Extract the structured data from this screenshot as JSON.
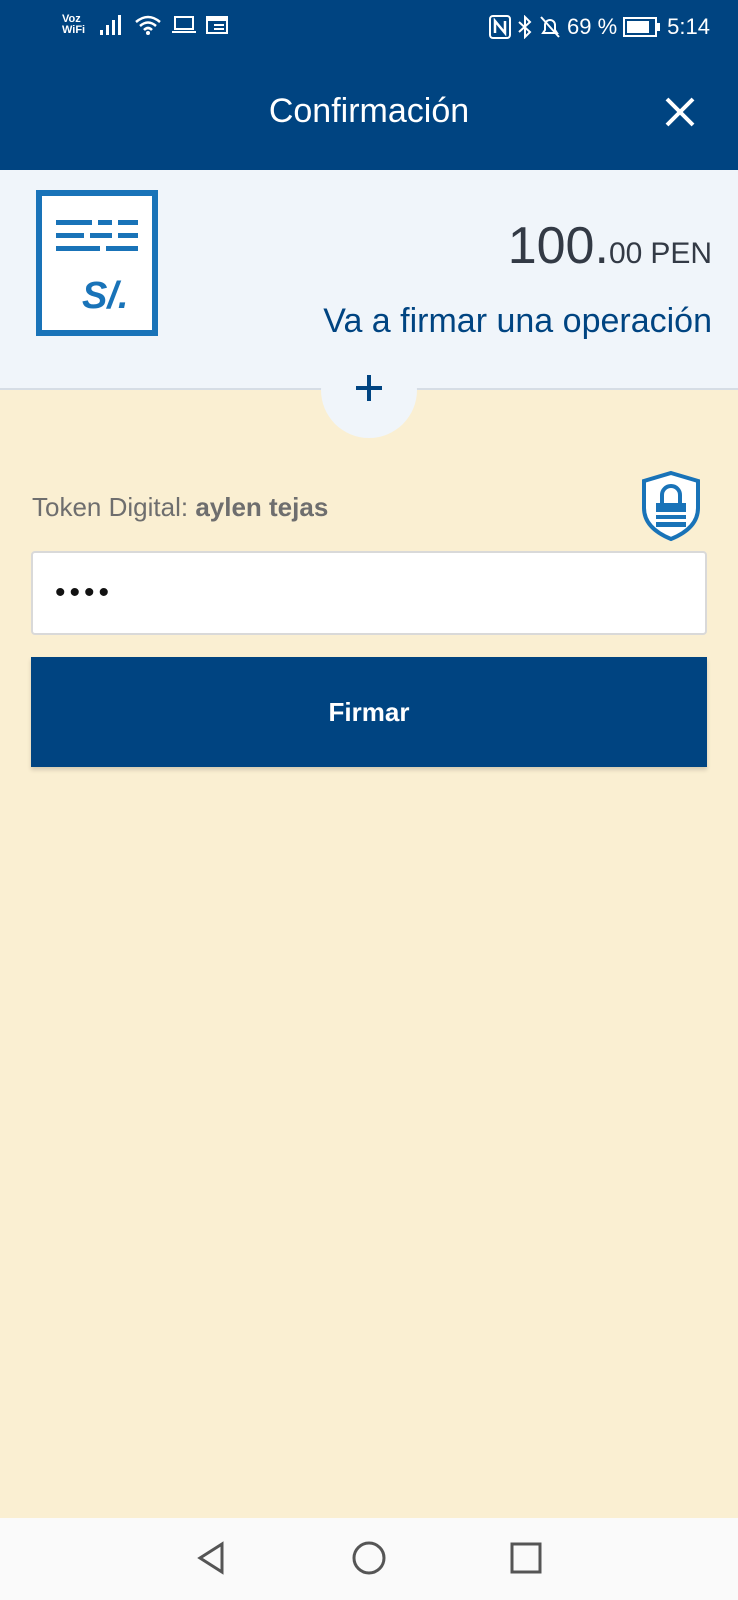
{
  "status_bar": {
    "network_label": "Voz\nWiFi",
    "battery_percent": "69 %",
    "time": "5:14"
  },
  "header": {
    "title": "Confirmación",
    "close_icon": "close-icon"
  },
  "summary": {
    "amount_integer": "100.",
    "amount_decimal": "00",
    "currency": "PEN",
    "subtitle": "Va a firmar una operación",
    "document_icon": "soles-document-icon"
  },
  "token": {
    "label": "Token Digital: ",
    "user": "aylen tejas",
    "pin_value": "••••",
    "icon": "lock-shield-icon"
  },
  "actions": {
    "sign_label": "Firmar"
  },
  "colors": {
    "brand_blue": "#004481",
    "accent_blue": "#1973b8",
    "background_beige": "#faefd2",
    "summary_bg": "#f0f5fa"
  }
}
